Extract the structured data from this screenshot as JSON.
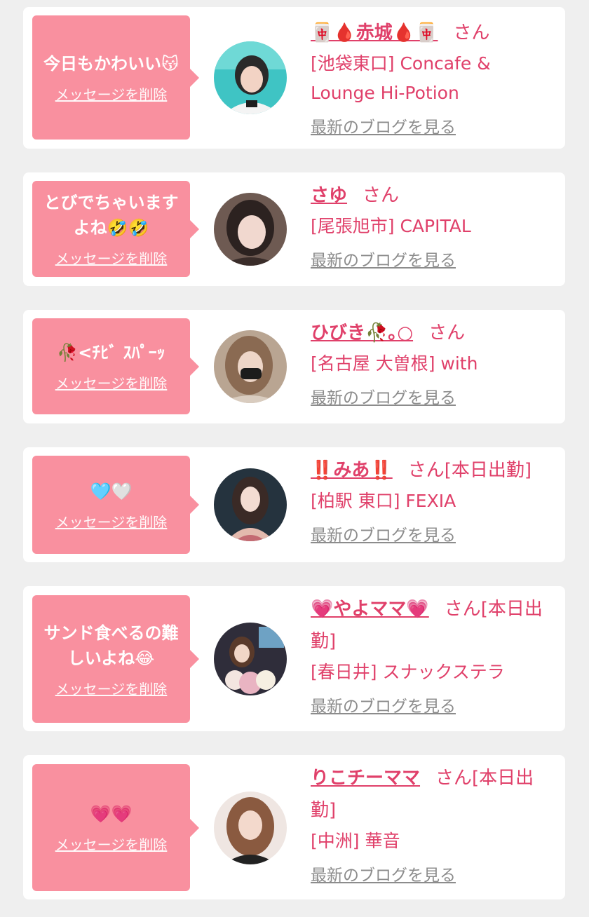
{
  "cards": [
    {
      "message": "今日もかわいい😽",
      "delete_label": "メッセージを削除",
      "name": "🀄️🩸赤城🩸🀄️",
      "san": "さん",
      "status": "",
      "shop": "[池袋東口] Concafe & Lounge Hi-Potion",
      "blog_label": "最新のブログを見る"
    },
    {
      "message": "とびでちゃいますよね🤣🤣",
      "delete_label": "メッセージを削除",
      "name": "さゆ",
      "san": "さん",
      "status": "",
      "shop": "[尾張旭市] CAPITAL",
      "blog_label": "最新のブログを見る"
    },
    {
      "message": "🥀<ﾁﾋﾞ ｽﾊﾟｰｯ",
      "delete_label": "メッセージを削除",
      "name": "ひびき🥀｡○",
      "san": "さん",
      "status": "",
      "shop": "[名古屋 大曽根] with",
      "blog_label": "最新のブログを見る"
    },
    {
      "message": "🩵🤍",
      "delete_label": "メッセージを削除",
      "name": "‼️みあ‼️",
      "san": "さん",
      "status": "[本日出勤]",
      "shop": "[柏駅 東口] FEXIA",
      "blog_label": "最新のブログを見る"
    },
    {
      "message": "サンド食べるの難しいよね😂",
      "delete_label": "メッセージを削除",
      "name": "💗やよママ💗",
      "san": "さん",
      "status": "[本日出勤]",
      "shop": "[春日井] スナックステラ",
      "blog_label": "最新のブログを見る"
    },
    {
      "message": "💗💗",
      "delete_label": "メッセージを削除",
      "name": "りこチーママ",
      "san": "さん",
      "status": "[本日出勤]",
      "shop": "[中洲] 華音",
      "blog_label": "最新のブログを見る"
    }
  ],
  "colors": {
    "accent": "#e0406a",
    "bubble": "#f9909f",
    "background": "#efefef",
    "link_gray": "#8c8c8c"
  }
}
